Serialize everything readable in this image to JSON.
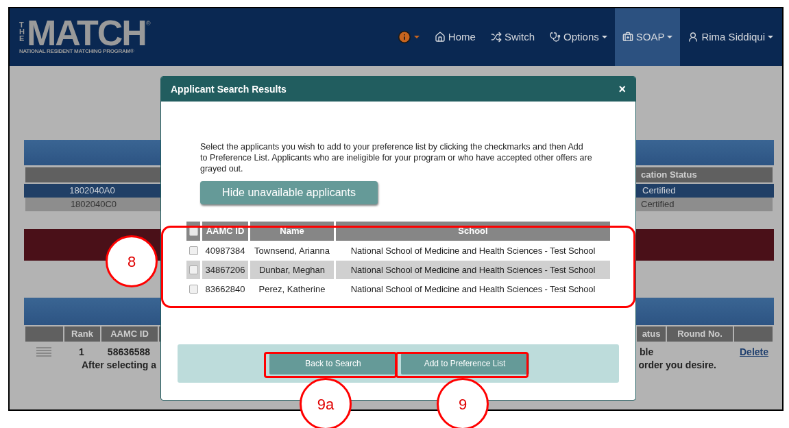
{
  "header": {
    "logo": {
      "side": "THE",
      "title": "MATCH",
      "mark": "®",
      "subtitle": "NATIONAL RESIDENT MATCHING PROGRAM®"
    },
    "nav": [
      {
        "kind": "info",
        "has_menu": true,
        "selected": false
      },
      {
        "kind": "home",
        "label": "Home",
        "has_menu": false,
        "selected": false
      },
      {
        "kind": "switch",
        "label": "Switch",
        "has_menu": false,
        "selected": false
      },
      {
        "kind": "options",
        "label": "Options",
        "has_menu": true,
        "selected": false
      },
      {
        "kind": "soap",
        "label": "SOAP",
        "has_menu": true,
        "selected": true
      },
      {
        "kind": "user",
        "label": "Rima Siddiqui",
        "has_menu": true,
        "selected": false
      }
    ]
  },
  "background": {
    "programs": {
      "header_right": "cation Status",
      "rows": [
        {
          "left": "1802040A0",
          "right": "Certified",
          "selected": true
        },
        {
          "left": "1802040C0",
          "right": "Certified",
          "selected": false
        }
      ]
    },
    "preference_list": {
      "columns": [
        "",
        "Rank",
        "AAMC ID",
        "atus",
        "Round No.",
        ""
      ],
      "rows": [
        {
          "rank": "1",
          "aamc_id": "58636588",
          "status": "ble",
          "action": "Delete"
        }
      ],
      "note_left": "After selecting a",
      "note_right": "order you desire."
    }
  },
  "modal": {
    "title": "Applicant Search Results",
    "close": "×",
    "instructions": "Select the applicants you wish to add to your preference list by clicking the checkmarks and then Add to Preference List. Applicants who are ineligible for your program or who have accepted other offers are grayed out.",
    "toggle_button": "Hide unavailable applicants",
    "table": {
      "select_all_checked": false,
      "columns": [
        "AAMC ID",
        "Name",
        "School"
      ],
      "rows": [
        {
          "aamc_id": "40987384",
          "name": "Townsend, Arianna",
          "school": "National School of Medicine and Health Sciences - Test School",
          "checked": false,
          "grayed": false
        },
        {
          "aamc_id": "34867206",
          "name": "Dunbar, Meghan",
          "school": "National School of Medicine and Health Sciences - Test School",
          "checked": false,
          "grayed": true
        },
        {
          "aamc_id": "83662840",
          "name": "Perez, Katherine",
          "school": "National School of Medicine and Health Sciences - Test School",
          "checked": false,
          "grayed": false
        }
      ]
    },
    "buttons": [
      "Back to Search",
      "Add to Preference List"
    ]
  },
  "annotations": [
    "8",
    "9a",
    "9"
  ]
}
